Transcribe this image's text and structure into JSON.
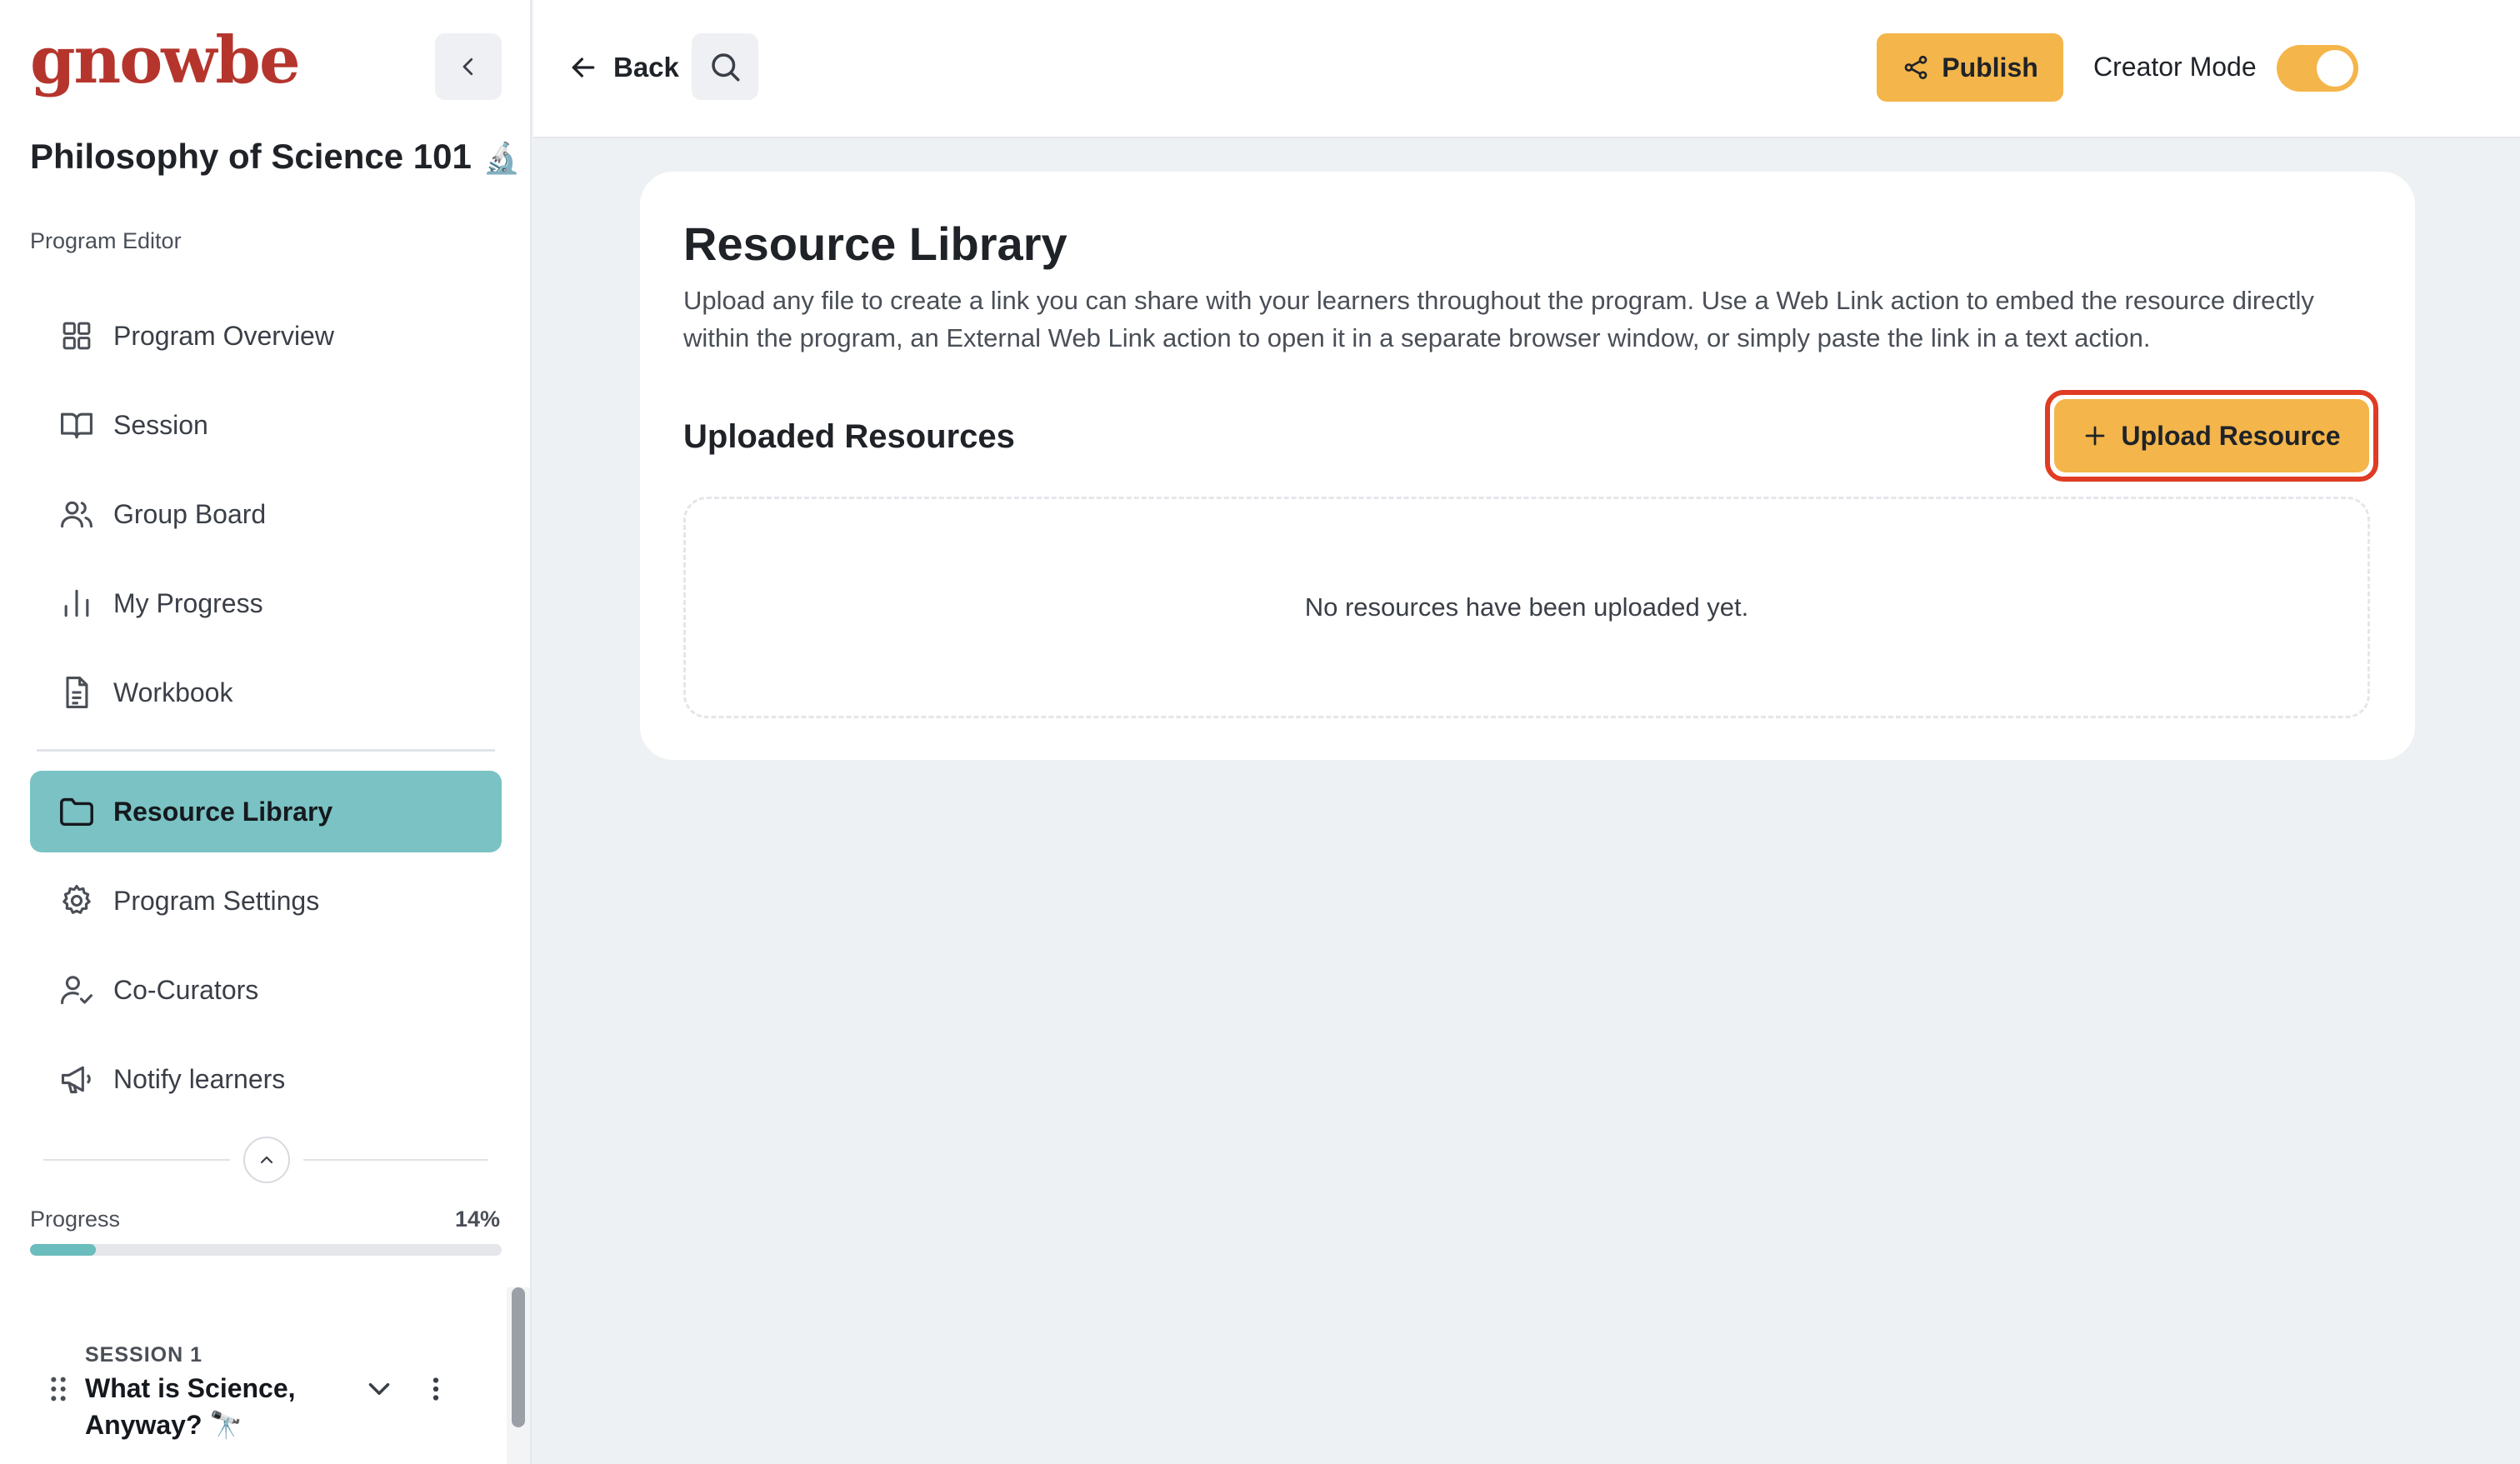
{
  "sidebar": {
    "logo": "gnowbe",
    "program_title": "Philosophy of Science 101",
    "program_emoji": "🔬",
    "section_label": "Program Editor",
    "items": [
      {
        "label": "Program Overview",
        "icon": "grid-icon"
      },
      {
        "label": "Session",
        "icon": "book-open-icon"
      },
      {
        "label": "Group Board",
        "icon": "users-icon"
      },
      {
        "label": "My Progress",
        "icon": "bar-chart-icon"
      },
      {
        "label": "Workbook",
        "icon": "document-icon"
      },
      {
        "label": "Resource Library",
        "icon": "folder-icon",
        "active": true
      },
      {
        "label": "Program Settings",
        "icon": "gear-icon"
      },
      {
        "label": "Co-Curators",
        "icon": "user-check-icon"
      },
      {
        "label": "Notify learners",
        "icon": "megaphone-icon"
      }
    ],
    "progress": {
      "label": "Progress",
      "value_text": "14%",
      "value": 0.14
    },
    "session": {
      "kicker": "SESSION 1",
      "title": "What is Science, Anyway? 🔭"
    }
  },
  "topbar": {
    "back_label": "Back",
    "publish_label": "Publish",
    "creator_mode_label": "Creator Mode",
    "creator_mode_on": true
  },
  "main": {
    "title": "Resource Library",
    "description": "Upload any file to create a link you can share with your learners throughout the program. Use a Web Link action to embed the resource directly within the program, an External Web Link action to open it in a separate browser window, or simply paste the link in a text action.",
    "subtitle": "Uploaded Resources",
    "upload_label": "Upload Resource",
    "empty_message": "No resources have been uploaded yet."
  },
  "colors": {
    "brand": "#b5352d",
    "accent": "#f4b54a",
    "active_nav": "#7ac2c3",
    "highlight": "#e03b24"
  }
}
